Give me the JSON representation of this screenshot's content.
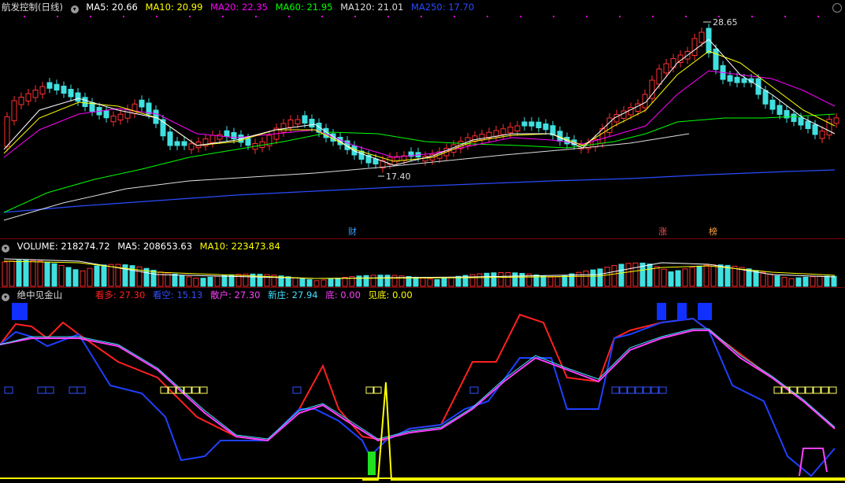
{
  "price": {
    "title": "航发控制(日线)",
    "ma": [
      {
        "label": "MA5: 20.66",
        "color": "#ffffff"
      },
      {
        "label": "MA10: 20.99",
        "color": "#ffff00"
      },
      {
        "label": "MA20: 22.35",
        "color": "#ff00ff"
      },
      {
        "label": "MA60: 21.95",
        "color": "#00ff00"
      },
      {
        "label": "MA120: 21.01",
        "color": "#dddddd"
      },
      {
        "label": "MA250: 17.70",
        "color": "#2a4cff"
      }
    ],
    "high_label": "28.65",
    "low_label": "17.40",
    "markers": [
      {
        "text": "财",
        "color": "#3aa0ff"
      },
      {
        "text": "涨",
        "color": "#ff5050"
      },
      {
        "text": "榜",
        "color": "#ffa040"
      }
    ]
  },
  "volume": {
    "items": [
      {
        "label": "VOLUME: 218274.72",
        "color": "#ffffff"
      },
      {
        "label": "MA5: 208653.63",
        "color": "#ffffff"
      },
      {
        "label": "MA10: 223473.84",
        "color": "#ffff00"
      }
    ]
  },
  "indicator": {
    "title": "绝中见金山",
    "items": [
      {
        "label": "看多: 27.30",
        "color": "#ff2020"
      },
      {
        "label": "看空: 15.13",
        "color": "#3050ff"
      },
      {
        "label": "散户: 27.30",
        "color": "#ff40ff"
      },
      {
        "label": "新庄: 27.94",
        "color": "#40e0ff"
      },
      {
        "label": "底: 0.00",
        "color": "#ff40ff"
      },
      {
        "label": "见底: 0.00",
        "color": "#ffff00"
      }
    ]
  },
  "colors": {
    "up": "#ff3030",
    "down": "#40e0e0",
    "ma5": "#ffffff",
    "ma10": "#ffff00",
    "ma20": "#ff00ff",
    "ma60": "#00ff00",
    "ma120": "#dddddd",
    "ma250": "#2a4cff"
  }
}
